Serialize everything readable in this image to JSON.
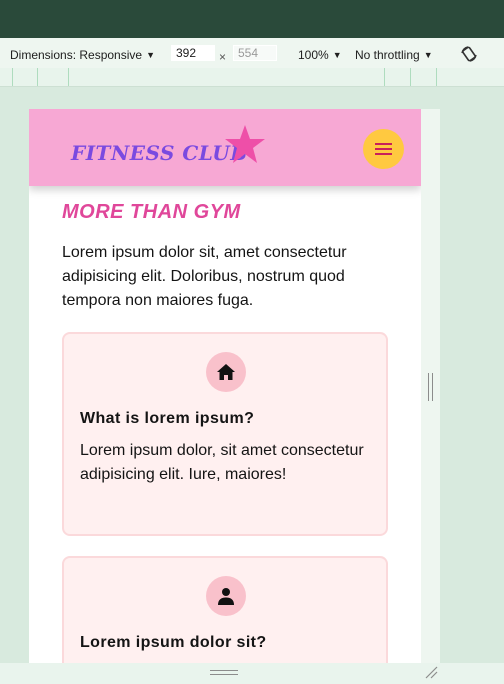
{
  "devtools": {
    "dimensions_label": "Dimensions: Responsive",
    "width_value": "392",
    "height_value": "554",
    "times": "×",
    "zoom_label": "100%",
    "throttling_label": "No throttling"
  },
  "site": {
    "logo": "FITNESS CLUB",
    "section_title": "MORE THAN GYM",
    "intro": "Lorem ipsum dolor sit, amet consectetur adipisicing elit. Doloribus, nostrum quod tempora non maiores fuga.",
    "cards": [
      {
        "icon": "home-icon",
        "title": "What is lorem ipsum?",
        "text": "Lorem ipsum dolor, sit amet consectetur adipisicing elit. Iure, maiores!"
      },
      {
        "icon": "person-icon",
        "title": "Lorem ipsum dolor sit?",
        "text": ""
      }
    ]
  },
  "colors": {
    "header_bg": "#f7a8d4",
    "logo": "#7a4ae0",
    "star": "#ee4fa8",
    "menu_button": "#ffc940",
    "section_title": "#e0479a",
    "card_bg": "#fff0f0",
    "card_icon_bg": "#f9c1cb"
  }
}
